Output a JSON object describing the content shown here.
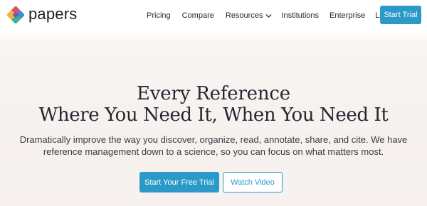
{
  "brand": {
    "name": "papers",
    "logo_icon": "papers-logo-icon",
    "accent": "#2b9ac9"
  },
  "nav": {
    "links": [
      {
        "label": "Pricing"
      },
      {
        "label": "Compare"
      },
      {
        "label": "Resources",
        "icon": "chevron-down-icon"
      },
      {
        "label": "Institutions"
      },
      {
        "label": "Enterprise"
      },
      {
        "label": "Log In"
      }
    ],
    "cta_label": "Start Trial"
  },
  "hero": {
    "title_line1": "Every Reference",
    "title_line2": "Where You Need It, When You Need It",
    "subtitle_line1": "Dramatically improve the way you discover, organize, read, annotate, share, and cite. We have",
    "subtitle_line2": "reference management down to a science, so you can focus on what matters most.",
    "primary_cta": "Start Your Free Trial",
    "secondary_cta": "Watch Video"
  }
}
